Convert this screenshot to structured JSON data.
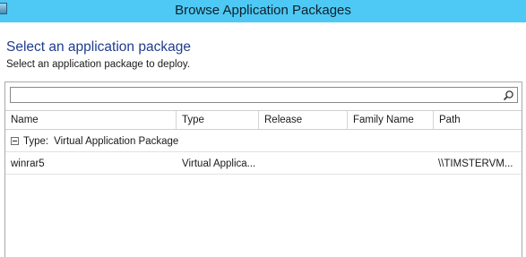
{
  "window": {
    "title": "Browse Application Packages"
  },
  "page": {
    "heading": "Select an application package",
    "subheading": "Select an application package to deploy."
  },
  "search": {
    "value": "",
    "placeholder": ""
  },
  "table": {
    "columns": [
      "Name",
      "Type",
      "Release",
      "Family Name",
      "Path"
    ],
    "group": {
      "label": "Type:",
      "value": "Virtual Application Package"
    },
    "rows": [
      {
        "name": "winrar5",
        "type": "Virtual Applica...",
        "release": "",
        "family_name": "",
        "path": "\\\\TIMSTERVM..."
      }
    ]
  },
  "colors": {
    "titlebar": "#4ec9f5",
    "heading": "#1e3d8f"
  }
}
